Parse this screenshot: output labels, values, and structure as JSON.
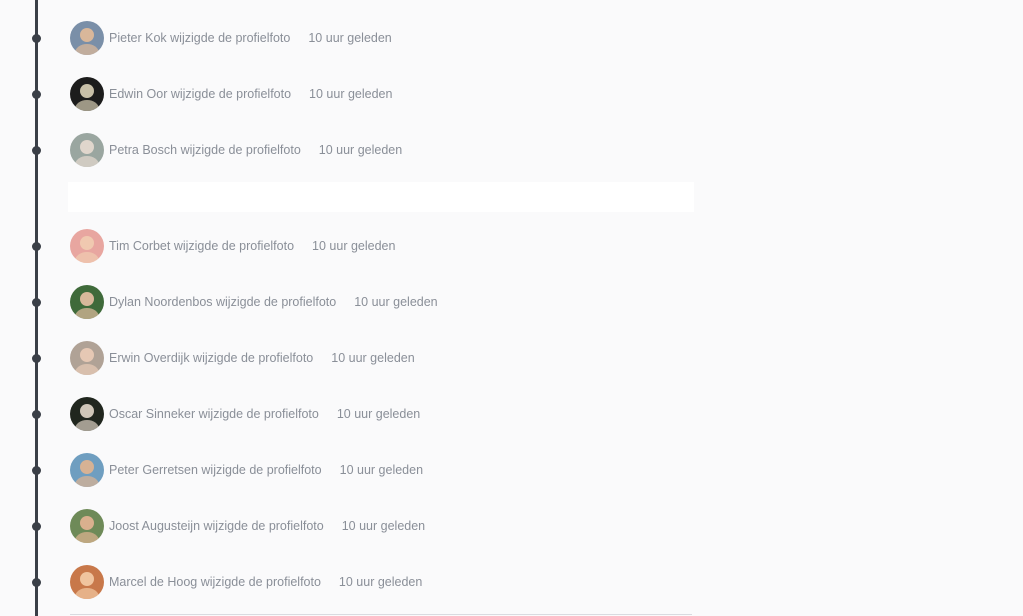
{
  "activity": [
    {
      "text": "Pieter Kok wijzigde de profielfoto",
      "time": "10 uur geleden",
      "avatar": {
        "bg": "#7a8fa8",
        "face": "#d9b79a"
      }
    },
    {
      "text": "Edwin Oor wijzigde de profielfoto",
      "time": "10 uur geleden",
      "avatar": {
        "bg": "#1c1c1c",
        "face": "#c8c0a8"
      }
    },
    {
      "text": "Petra Bosch wijzigde de profielfoto",
      "time": "10 uur geleden",
      "avatar": {
        "bg": "#9aa6a0",
        "face": "#e0d6cc"
      }
    },
    {
      "text": "Tim Corbet wijzigde de profielfoto",
      "time": "10 uur geleden",
      "avatar": {
        "bg": "#e8a6a0",
        "face": "#f0c9b0"
      }
    },
    {
      "text": "Dylan Noordenbos wijzigde de profielfoto",
      "time": "10 uur geleden",
      "avatar": {
        "bg": "#3f6a3a",
        "face": "#d8b89a"
      }
    },
    {
      "text": "Erwin Overdijk wijzigde de profielfoto",
      "time": "10 uur geleden",
      "avatar": {
        "bg": "#b0a296",
        "face": "#e6c8b4"
      }
    },
    {
      "text": "Oscar Sinneker wijzigde de profielfoto",
      "time": "10 uur geleden",
      "avatar": {
        "bg": "#20261e",
        "face": "#cfc6b8"
      }
    },
    {
      "text": "Peter Gerretsen wijzigde de profielfoto",
      "time": "10 uur geleden",
      "avatar": {
        "bg": "#6f9ec0",
        "face": "#d7b294"
      }
    },
    {
      "text": "Joost Augusteijn wijzigde de profielfoto",
      "time": "10 uur geleden",
      "avatar": {
        "bg": "#6e8a58",
        "face": "#d9b08e"
      }
    },
    {
      "text": "Marcel de Hoog wijzigde de profielfoto",
      "time": "10 uur geleden",
      "avatar": {
        "bg": "#c8784a",
        "face": "#f0c49e"
      }
    }
  ]
}
